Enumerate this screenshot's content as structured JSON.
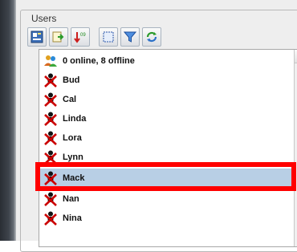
{
  "group": {
    "title": "Users"
  },
  "toolbar": {
    "buttons": [
      {
        "name": "user-profile-icon"
      },
      {
        "name": "export-icon"
      },
      {
        "name": "sort-users-icon"
      },
      {
        "name": "select-all-icon"
      },
      {
        "name": "filter-icon"
      },
      {
        "name": "refresh-icon"
      }
    ]
  },
  "list": {
    "header": {
      "label": "0 online, 8 offline",
      "icon": "users-group-icon"
    },
    "users": [
      {
        "name": "Bud",
        "status": "offline"
      },
      {
        "name": "Cal",
        "status": "offline"
      },
      {
        "name": "Linda",
        "status": "offline"
      },
      {
        "name": "Lora",
        "status": "offline"
      },
      {
        "name": "Lynn",
        "status": "offline"
      },
      {
        "name": "Mack",
        "status": "offline",
        "selected": true
      },
      {
        "name": "Nan",
        "status": "offline"
      },
      {
        "name": "Nina",
        "status": "offline"
      }
    ]
  },
  "colors": {
    "selection": "#b8cfe5",
    "highlight": "#ff0000",
    "offline_icon": "#cc0000"
  }
}
